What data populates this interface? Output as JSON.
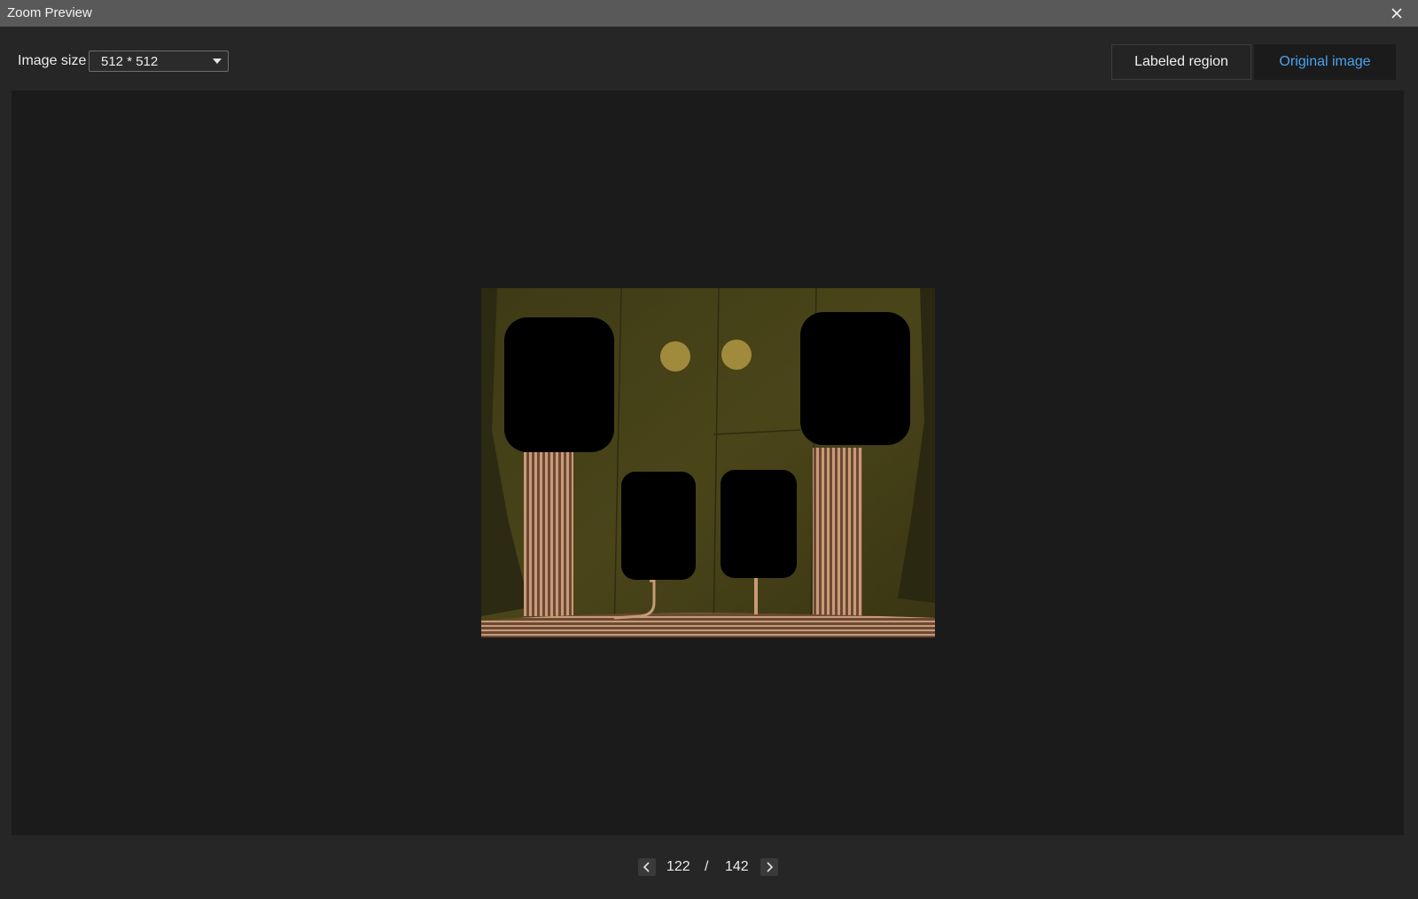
{
  "window": {
    "title": "Zoom Preview"
  },
  "toolbar": {
    "image_size_label": "Image size",
    "image_size_value": "512 * 512",
    "view_modes": [
      {
        "label": "Labeled region",
        "active": false
      },
      {
        "label": "Original image",
        "active": true
      }
    ]
  },
  "pager": {
    "current": "122",
    "separator": "/",
    "total": "142"
  },
  "icons": {
    "close": "close-icon",
    "dropdown": "chevron-down-icon",
    "prev": "chevron-left-icon",
    "next": "chevron-right-icon"
  },
  "colors": {
    "accent": "#4aa3f0",
    "titlebar": "#595959",
    "panel": "#262626",
    "viewer": "#1b1b1b"
  }
}
